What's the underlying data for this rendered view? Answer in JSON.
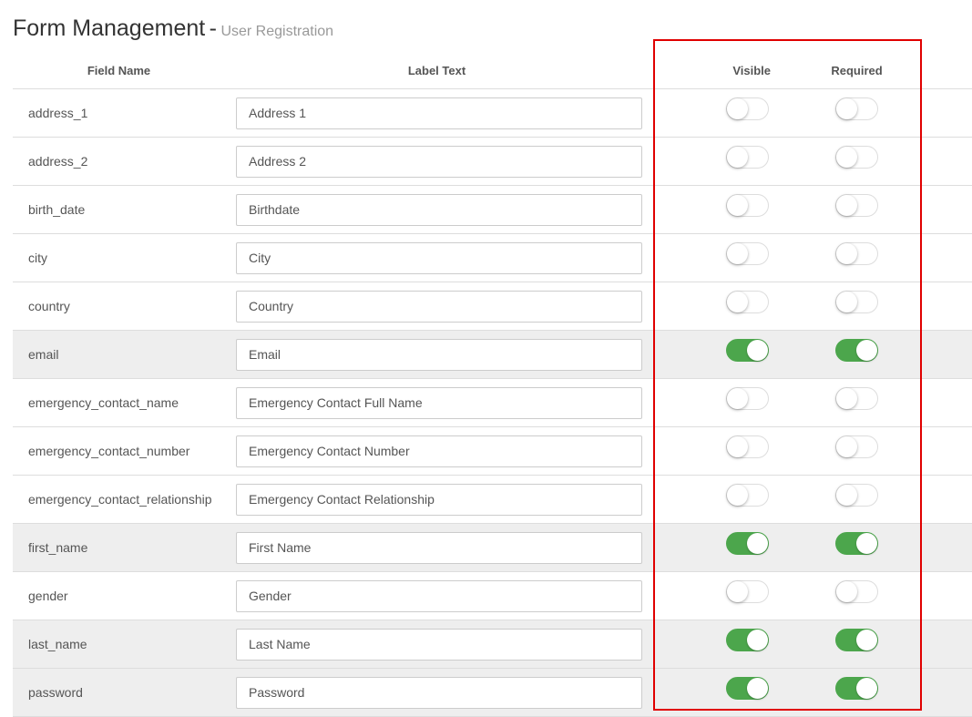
{
  "header": {
    "title": "Form Management",
    "separator": "-",
    "subtitle": "User Registration"
  },
  "columns": {
    "field_name": "Field Name",
    "label_text": "Label Text",
    "visible": "Visible",
    "required": "Required"
  },
  "colors": {
    "toggle_on": "#4ca64c",
    "highlight_border": "#e00000",
    "enabled_row_bg": "#eeeeee"
  },
  "rows": [
    {
      "field": "address_1",
      "label": "Address 1",
      "visible": false,
      "required": false
    },
    {
      "field": "address_2",
      "label": "Address 2",
      "visible": false,
      "required": false
    },
    {
      "field": "birth_date",
      "label": "Birthdate",
      "visible": false,
      "required": false
    },
    {
      "field": "city",
      "label": "City",
      "visible": false,
      "required": false
    },
    {
      "field": "country",
      "label": "Country",
      "visible": false,
      "required": false
    },
    {
      "field": "email",
      "label": "Email",
      "visible": true,
      "required": true
    },
    {
      "field": "emergency_contact_name",
      "label": "Emergency Contact Full Name",
      "visible": false,
      "required": false
    },
    {
      "field": "emergency_contact_number",
      "label": "Emergency Contact Number",
      "visible": false,
      "required": false
    },
    {
      "field": "emergency_contact_relationship",
      "label": "Emergency Contact Relationship",
      "visible": false,
      "required": false
    },
    {
      "field": "first_name",
      "label": "First Name",
      "visible": true,
      "required": true
    },
    {
      "field": "gender",
      "label": "Gender",
      "visible": false,
      "required": false
    },
    {
      "field": "last_name",
      "label": "Last Name",
      "visible": true,
      "required": true
    },
    {
      "field": "password",
      "label": "Password",
      "visible": true,
      "required": true
    }
  ]
}
